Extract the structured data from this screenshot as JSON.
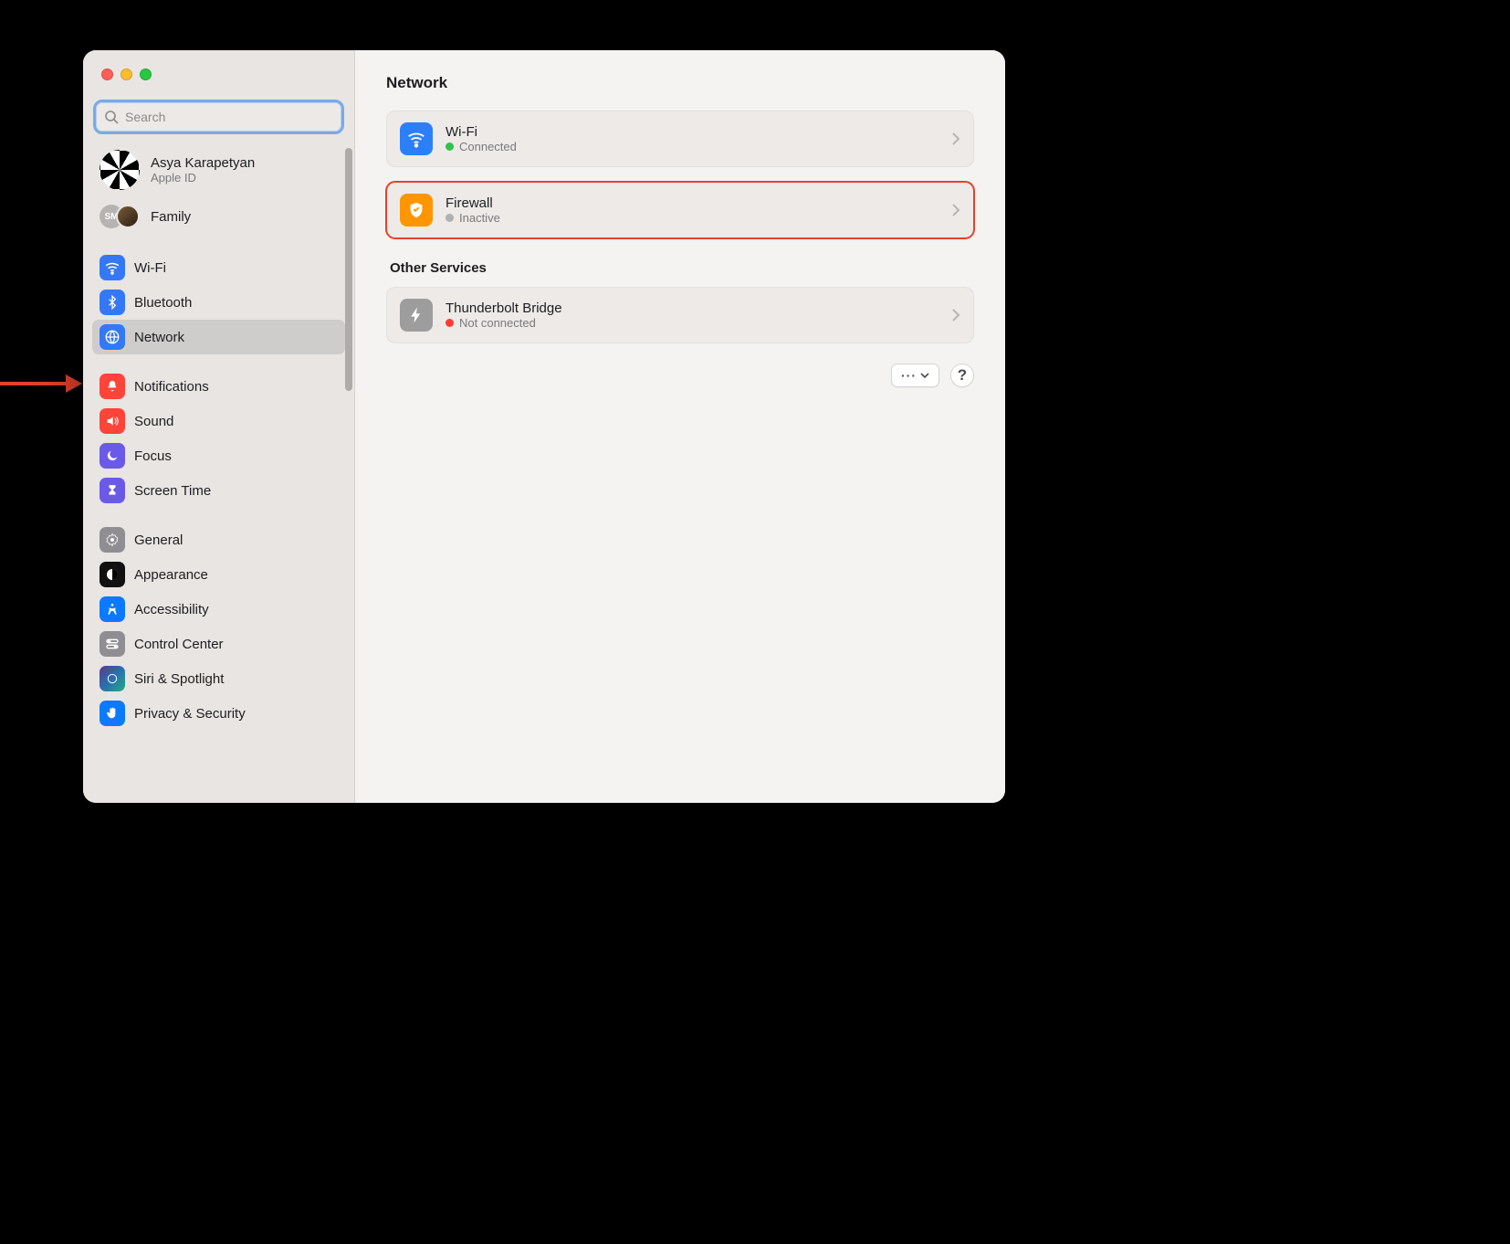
{
  "search": {
    "placeholder": "Search"
  },
  "user": {
    "name": "Asya Karapetyan",
    "sub": "Apple ID"
  },
  "family": {
    "label": "Family",
    "badge": "SM"
  },
  "sidebar": {
    "group1": [
      {
        "label": "Wi-Fi",
        "icon": "wifi"
      },
      {
        "label": "Bluetooth",
        "icon": "bluetooth"
      },
      {
        "label": "Network",
        "icon": "globe",
        "selected": true
      }
    ],
    "group2": [
      {
        "label": "Notifications",
        "icon": "bell"
      },
      {
        "label": "Sound",
        "icon": "speaker"
      },
      {
        "label": "Focus",
        "icon": "moon"
      },
      {
        "label": "Screen Time",
        "icon": "hourglass"
      }
    ],
    "group3": [
      {
        "label": "General",
        "icon": "gear"
      },
      {
        "label": "Appearance",
        "icon": "contrast"
      },
      {
        "label": "Accessibility",
        "icon": "accessibility"
      },
      {
        "label": "Control Center",
        "icon": "switches"
      },
      {
        "label": "Siri & Spotlight",
        "icon": "siri"
      },
      {
        "label": "Privacy & Security",
        "icon": "hand"
      }
    ]
  },
  "content": {
    "title": "Network",
    "rows1": [
      {
        "title": "Wi-Fi",
        "status": "Connected",
        "dot": "green",
        "icon": "wifi",
        "bg": "blue"
      },
      {
        "title": "Firewall",
        "status": "Inactive",
        "dot": "gray",
        "icon": "firewall",
        "bg": "orange",
        "highlight": true
      }
    ],
    "section2_title": "Other Services",
    "rows2": [
      {
        "title": "Thunderbolt Bridge",
        "status": "Not connected",
        "dot": "red",
        "icon": "bolt",
        "bg": "gray"
      }
    ],
    "more_label": "···",
    "help_label": "?"
  }
}
